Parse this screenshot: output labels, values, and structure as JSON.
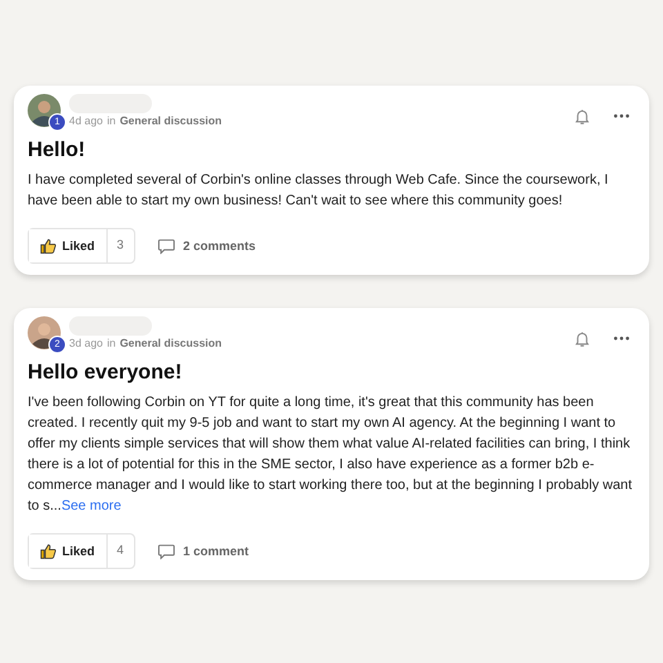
{
  "posts": [
    {
      "level": "1",
      "time": "4d ago",
      "in": "in",
      "category": "General discussion",
      "title": "Hello!",
      "body": "I have completed several of Corbin's online classes through Web Cafe. Since the coursework, I have been able to start my own business! Can't wait to see where this community goes!",
      "liked": true,
      "like_label": "Liked",
      "like_count": "3",
      "comments": "2 comments"
    },
    {
      "level": "2",
      "time": "3d ago",
      "in": "in",
      "category": "General discussion",
      "title": "Hello everyone!",
      "body": "I've been following Corbin on YT for quite a long time, it's great that this community has been created. I recently quit my 9-5 job and want to start my own AI agency. At the beginning I want to offer my clients simple services that will show them what value AI-related facilities can bring, I think there is a lot of potential for this in the SME sector, I also have experience as a former b2b e-commerce manager and I would like to start working there too, but at the beginning I probably want to s...",
      "see_more": "See more",
      "liked": true,
      "like_label": "Liked",
      "like_count": "4",
      "comments": "1 comment"
    }
  ]
}
